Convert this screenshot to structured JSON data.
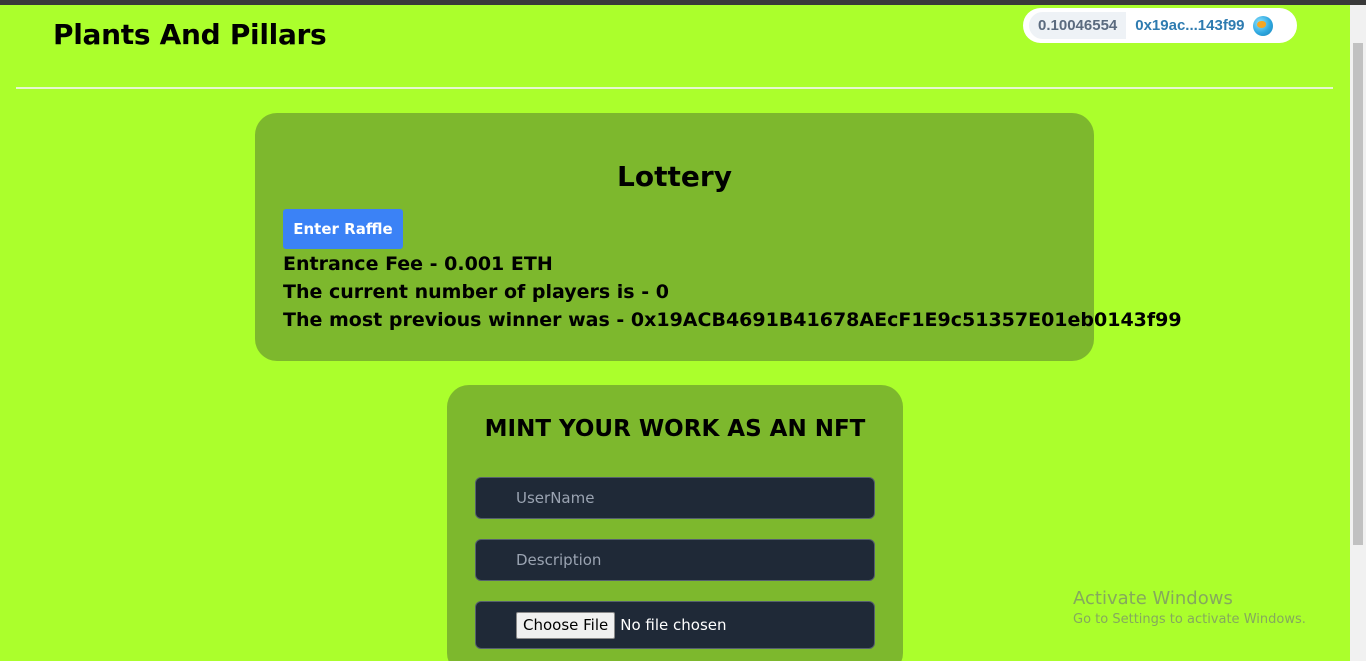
{
  "header": {
    "app_title": "Plants And Pillars",
    "wallet": {
      "balance": "0.10046554",
      "address": "0x19ac...143f99",
      "avatar_icon": "globe-icon"
    }
  },
  "lottery": {
    "title": "Lottery",
    "enter_button_label": "Enter Raffle",
    "entrance_fee_text": "Entrance Fee - 0.001 ETH",
    "players_text": "The current number of players is - 0",
    "winner_text": "The most previous winner was - 0x19ACB4691B41678AEcF1E9c51357E01eb0143f99"
  },
  "mint": {
    "title": "MINT YOUR WORK AS AN NFT",
    "username_placeholder": "UserName",
    "description_placeholder": "Description",
    "choose_file_label": "Choose File",
    "file_status": "No file chosen"
  },
  "watermark": {
    "title": "Activate Windows",
    "subtitle": "Go to Settings to activate Windows."
  },
  "colors": {
    "page_background": "#abff2c",
    "card_background": "#7db82d",
    "button_blue": "#3b82f6",
    "field_background": "#1f2937"
  }
}
